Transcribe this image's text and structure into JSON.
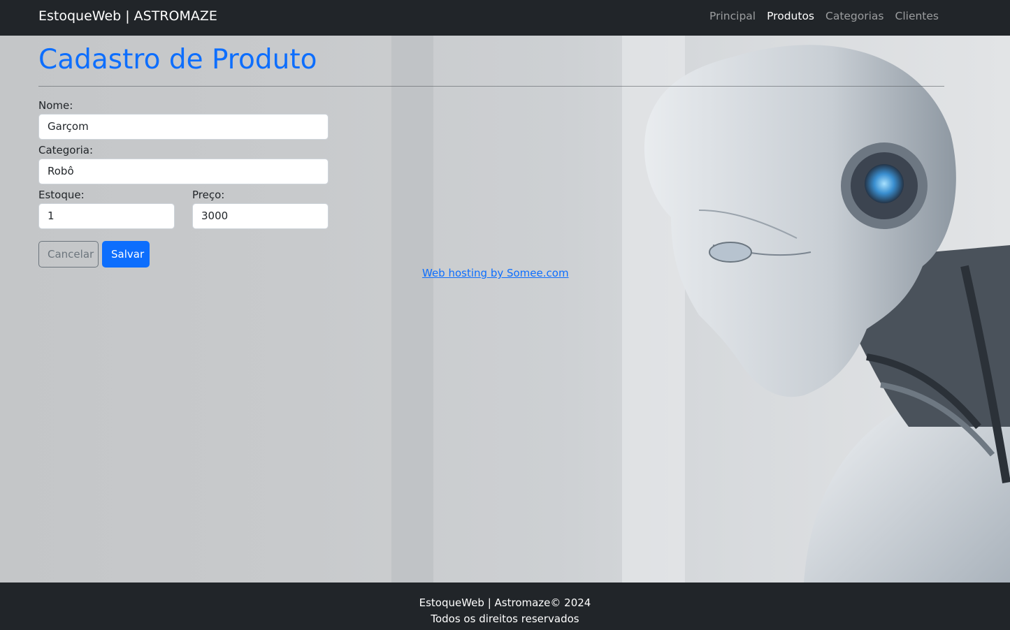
{
  "navbar": {
    "brand": "EstoqueWeb | ASTROMAZE",
    "links": [
      {
        "label": "Principal",
        "active": false
      },
      {
        "label": "Produtos",
        "active": true
      },
      {
        "label": "Categorias",
        "active": false
      },
      {
        "label": "Clientes",
        "active": false
      }
    ]
  },
  "main": {
    "title": "Cadastro de Produto",
    "form": {
      "nome": {
        "label": "Nome:",
        "value": "Garçom"
      },
      "categoria": {
        "label": "Categoria:",
        "value": "Robô"
      },
      "estoque": {
        "label": "Estoque:",
        "value": "1"
      },
      "preco": {
        "label": "Preço:",
        "value": "3000"
      }
    },
    "buttons": {
      "cancel_label": "Cancelar",
      "save_label": "Salvar"
    }
  },
  "hosting_link": "Web hosting by Somee.com",
  "footer": {
    "line1": "EstoqueWeb | Astromaze© 2024",
    "line2": "Todos os direitos reservados"
  },
  "colors": {
    "navbar_bg": "#212529",
    "primary": "#0d6efd",
    "secondary": "#6c757d"
  }
}
